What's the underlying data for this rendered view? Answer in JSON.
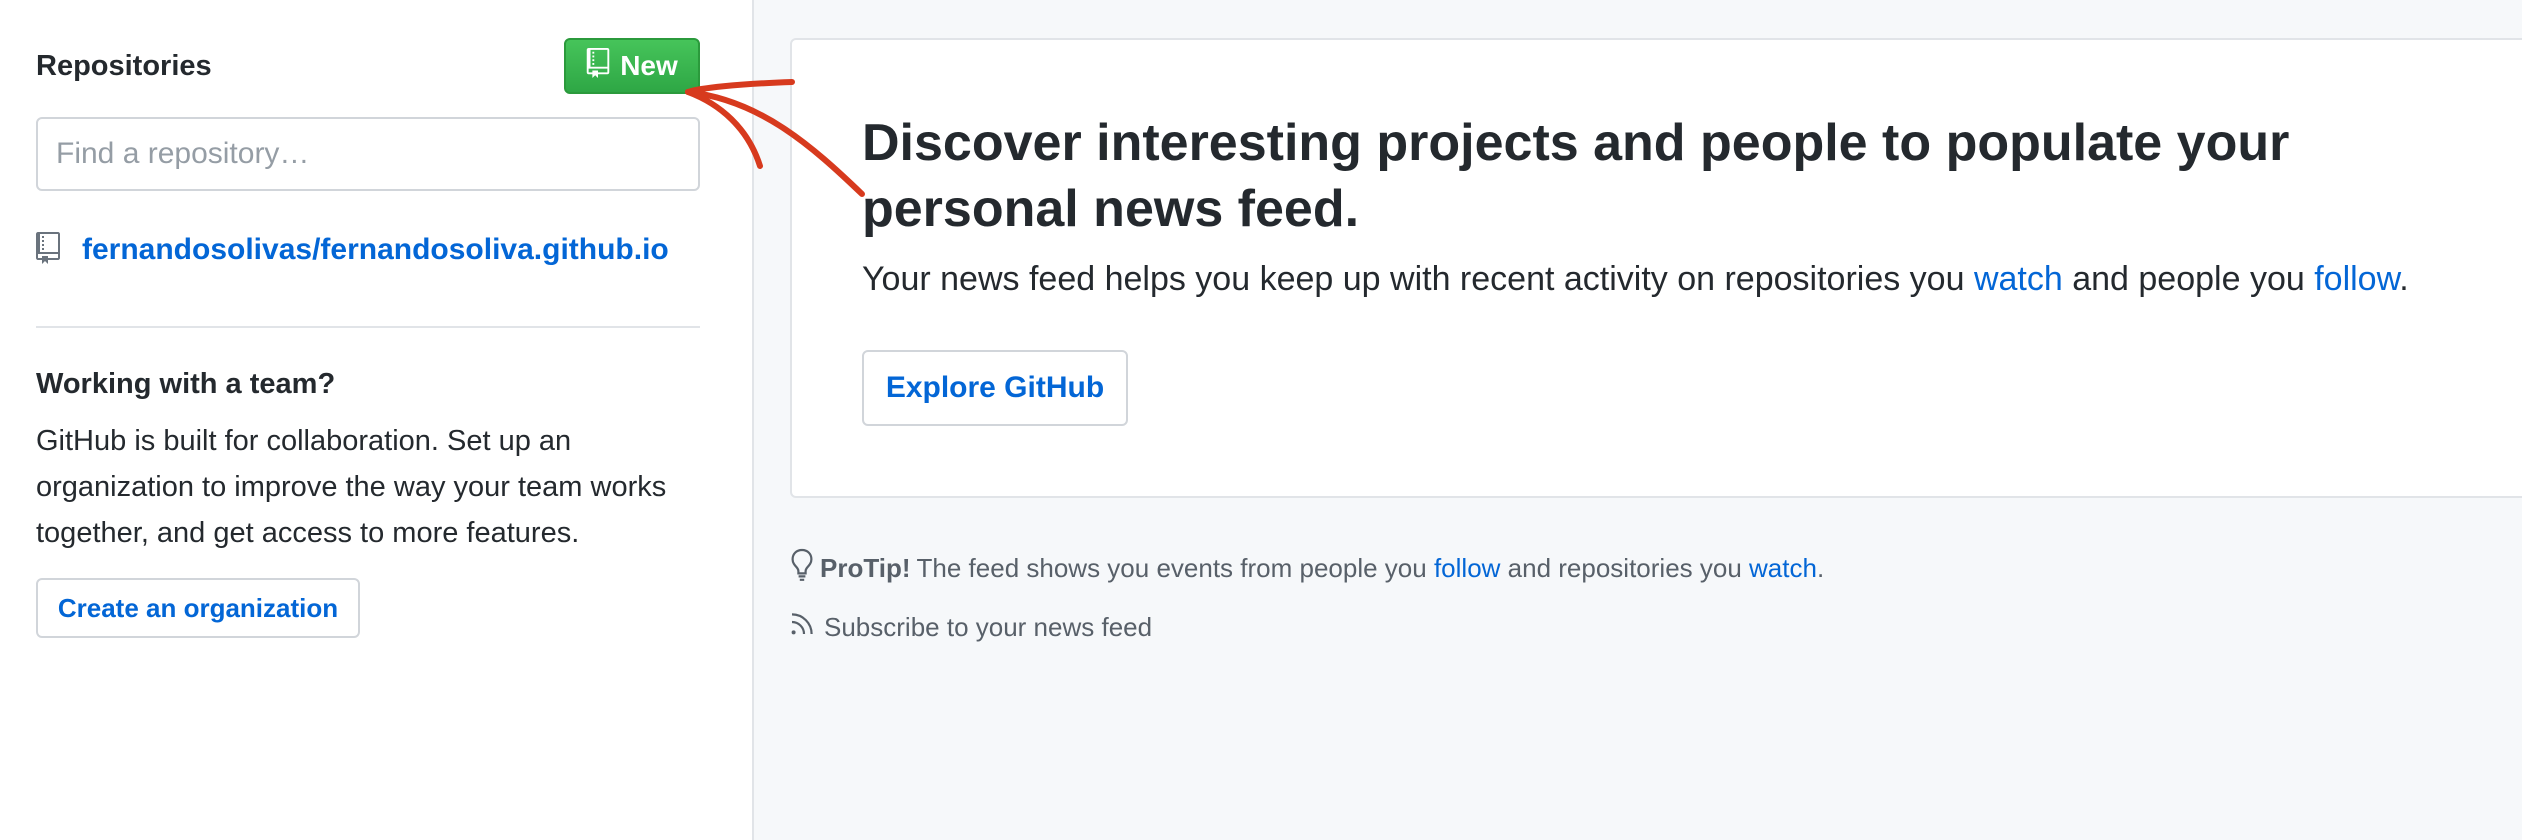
{
  "sidebar": {
    "repositories_title": "Repositories",
    "new_button_label": "New",
    "search_placeholder": "Find a repository…",
    "repos": [
      {
        "name": "fernandosolivas/fernandosoliva.github.io"
      }
    ],
    "team": {
      "title": "Working with a team?",
      "text": "GitHub is built for collaboration. Set up an organization to improve the way your team works together, and get access to more features.",
      "button_label": "Create an organization"
    }
  },
  "main": {
    "feed": {
      "title": "Discover interesting projects and people to populate your personal news feed.",
      "text_before": "Your news feed helps you keep up with recent activity on repositories you ",
      "watch_link": "watch",
      "text_middle": " and people you ",
      "follow_link": "follow",
      "text_after": ".",
      "explore_button": "Explore GitHub"
    },
    "protip": {
      "label": "ProTip!",
      "text_before": " The feed shows you events from people you ",
      "follow_link": "follow",
      "text_middle": " and repositories you ",
      "watch_link": "watch",
      "text_after": "."
    },
    "subscribe_label": "Subscribe to your news feed"
  },
  "colors": {
    "link": "#0366d6",
    "new_button": "#2ea745",
    "annotation": "#d73a1e",
    "main_bg": "#f6f8fa"
  },
  "icons": [
    "repo-book-icon",
    "repo-icon",
    "lightbulb-icon",
    "rss-icon"
  ]
}
